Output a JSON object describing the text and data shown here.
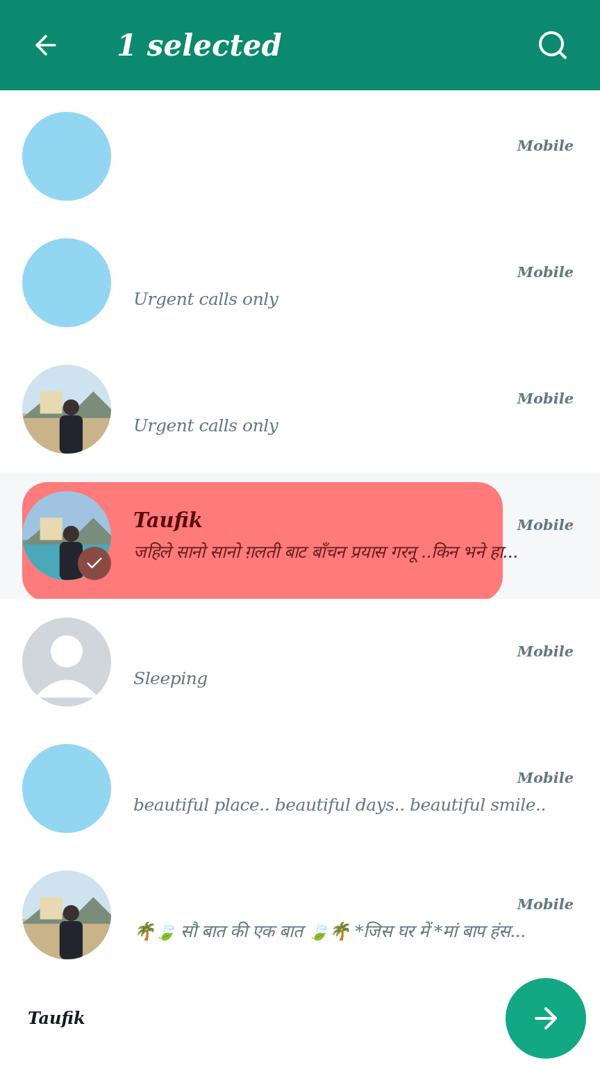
{
  "header": {
    "title": "1 selected"
  },
  "contacts": [
    {
      "avatar": {
        "kind": "blank"
      },
      "type": "Mobile",
      "selected": false
    },
    {
      "avatar": {
        "kind": "blank"
      },
      "type": "Mobile",
      "status": "Urgent calls only",
      "selected": false
    },
    {
      "type": "Mobile",
      "status": "Urgent calls only",
      "selected": false
    },
    {
      "name": "Taufik",
      "type": "Mobile",
      "status": "जहिले सानो सानो ग़लती बाट बाँचन प्रयास गरनू ..किन भने हा...",
      "selected": true
    },
    {
      "avatar": {
        "kind": "placeholder"
      },
      "type": "Mobile",
      "status": "Sleeping",
      "selected": false
    },
    {
      "avatar": {
        "kind": "blank"
      },
      "type": "Mobile",
      "status": "beautiful place.. beautiful days.. beautiful smile..",
      "selected": false
    },
    {
      "type": "Mobile",
      "status": "🌴🍃 सौ बात की एक बात 🍃🌴 *जिस घर में *मां बाप हंस...",
      "selected": false
    }
  ],
  "selection_bar": {
    "names": [
      "Taufik"
    ]
  }
}
